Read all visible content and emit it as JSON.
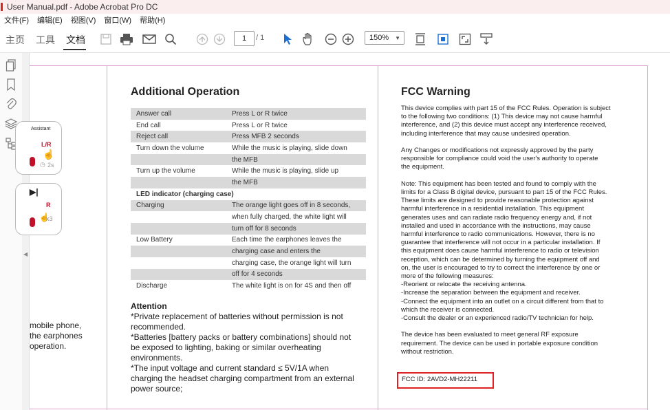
{
  "window": {
    "title": "User Manual.pdf - Adobe Acrobat Pro DC"
  },
  "menu": [
    "文件(F)",
    "编辑(E)",
    "视图(V)",
    "窗口(W)",
    "帮助(H)"
  ],
  "tabs": [
    {
      "label": "主页"
    },
    {
      "label": "工具"
    },
    {
      "label": "文档"
    }
  ],
  "toolbar": {
    "page_current": "1",
    "page_total": "/ 1",
    "zoom": "150%"
  },
  "left_column": {
    "assistant_label": "Assistant",
    "lr_label": "L/R",
    "hold_label": "2s",
    "play_icon": "▶|",
    "r_label": "R",
    "times_label": "x3",
    "paragraph": [
      "mobile phone,",
      "the earphones",
      "operation."
    ]
  },
  "operation": {
    "title": "Additional Operation",
    "rows": [
      {
        "c1": "Answer call",
        "c2": "Press L or R twice",
        "shade": true
      },
      {
        "c1": "End call",
        "c2": "Press L or R twice",
        "shade": false
      },
      {
        "c1": "Reject call",
        "c2": "Press MFB 2 seconds",
        "shade": true
      },
      {
        "c1": "Turn down the volume",
        "c2": "While the music is playing, slide down",
        "shade": false
      },
      {
        "c1": "",
        "c2": "the MFB",
        "shade": true
      },
      {
        "c1": "Turn up the volume",
        "c2": "While the music is playing, slide up",
        "shade": false
      },
      {
        "c1": "",
        "c2": "the MFB",
        "shade": true
      },
      {
        "c1": "LED indicator  (charging case)",
        "c2": "",
        "shade": false,
        "section": true
      },
      {
        "c1": "Charging",
        "c2": "The orange light goes off in 8 seconds,",
        "shade": true
      },
      {
        "c1": "",
        "c2": "when fully charged, the white light will",
        "shade": false
      },
      {
        "c1": "",
        "c2": "turn off for 8 seconds",
        "shade": true
      },
      {
        "c1": "Low Battery",
        "c2": "Each time the earphones leaves the",
        "shade": false
      },
      {
        "c1": "",
        "c2": "charging case and enters the",
        "shade": true
      },
      {
        "c1": "",
        "c2": "charging case, the orange light will turn",
        "shade": false
      },
      {
        "c1": "",
        "c2": "off for 4 seconds",
        "shade": true
      },
      {
        "c1": "Discharge",
        "c2": "The white light is on for 4S and then off",
        "shade": false
      }
    ]
  },
  "attention": {
    "title": "Attention",
    "lines": [
      "*Private replacement of batteries without permission is not",
      "recommended.",
      "*Batteries [battery packs or battery combinations] should not",
      "be exposed to lighting, baking or similar overheating",
      "environments.",
      "*The input voltage and current standard ≤ 5V/1A when",
      "charging the headset charging compartment from an external",
      "power source;"
    ]
  },
  "fcc": {
    "title": "FCC Warning",
    "paragraphs": [
      [
        "This device complies with part 15 of the FCC Rules. Operation is subject",
        "to the following two conditions: (1) This device may not cause harmful",
        "interference, and (2) this device must accept any interference received,",
        "including interference that may cause undesired operation."
      ],
      [
        "Any Changes or modifications not expressly approved by the party",
        "responsible for compliance could void the user's authority to operate",
        "the equipment."
      ],
      [
        "Note: This equipment has been tested and found to comply with the",
        "limits for a Class B digital device, pursuant to part 15 of the FCC Rules.",
        "These limits are designed to provide reasonable protection against",
        "harmful interference in a residential installation. This equipment",
        "generates uses and can radiate radio frequency energy and, if not",
        "installed and used in accordance with the instructions, may cause",
        "harmful interference to radio communications. However, there is no",
        "guarantee that interference will not occur in a particular installation. If",
        "this equipment does cause harmful interference to radio or television",
        "reception, which can be determined by turning the equipment off and",
        "on, the user is encouraged to try to correct the interference by one or",
        "more of the following measures:",
        "-Reorient or relocate the receiving antenna.",
        "-Increase the separation between the equipment and receiver.",
        "-Connect the equipment into an outlet on a circuit different from that to",
        "which the receiver is connected.",
        "-Consult the dealer or an experienced radio/TV technician for help."
      ],
      [
        "The device has been evaluated to meet general RF exposure",
        "requirement. The device can be used in portable exposure condition",
        "without restriction."
      ]
    ],
    "fcc_id": "FCC ID: 2AVD2-MH22211"
  },
  "colors": {
    "highlight_box": "#e02020",
    "page_guide": "#e0a0d8",
    "table_shade": "#d9d9d9",
    "brand_red": "#c0102a"
  },
  "icons": [
    "save-icon",
    "print-icon",
    "mail-icon",
    "search-icon",
    "page-up-icon",
    "page-down-icon",
    "select-arrow-icon",
    "hand-icon",
    "zoom-out-icon",
    "zoom-in-icon",
    "fit-page-icon",
    "rotate-icon",
    "fullscreen-icon",
    "read-mode-icon",
    "pages-icon",
    "bookmark-icon",
    "attachment-icon",
    "layers-icon",
    "structure-icon"
  ]
}
